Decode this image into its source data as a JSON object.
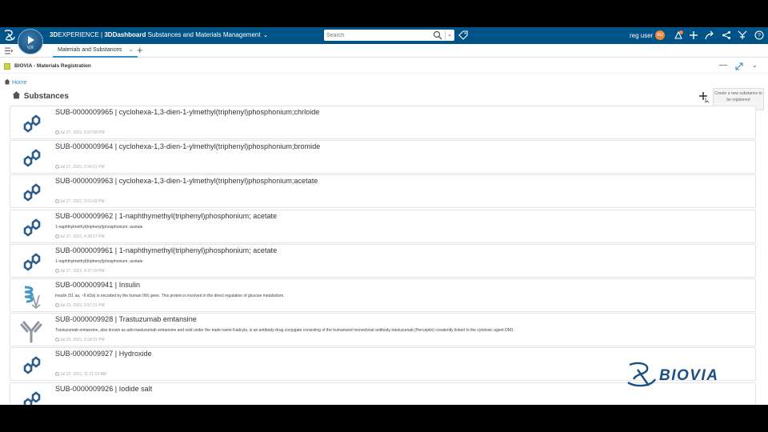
{
  "topbar": {
    "brand": "3D",
    "brand_rest": "EXPERIENCE",
    "separator": " | ",
    "dashboard": "3DDashboard",
    "dashboard_name": "Substances and Materials Management",
    "compass_label": "V,R",
    "search_placeholder": "Search",
    "user": "reg user",
    "avatar_initials": "RU",
    "notification_count": "5",
    "bar_color": "#005386"
  },
  "tabs": [
    {
      "label": "Materials and Substances"
    }
  ],
  "widget": {
    "title": "BIOVIA - Materials Registration"
  },
  "breadcrumb": {
    "home": "Home"
  },
  "page": {
    "title": "Substances",
    "add_tooltip": "Create a new substance to be registered"
  },
  "substances": [
    {
      "title": "SUB-0000009965 | cyclohexa-1,3-dien-1-ylmethyl(triphenyl)phosphonium;chrloide",
      "desc": "",
      "date": "Jul 27, 2021, 5:07:58 PM",
      "icon": "molecule-icon"
    },
    {
      "title": "SUB-0000009964 | cyclohexa-1,3-dien-1-ylmethyl(triphenyl)phosphonium;bromide",
      "desc": "",
      "date": "Jul 27, 2021, 5:04:21 PM",
      "icon": "molecule-icon"
    },
    {
      "title": "SUB-0000009963 | cyclohexa-1,3-dien-1-ylmethyl(triphenyl)phosphonium;acetate",
      "desc": "",
      "date": "Jul 27, 2021, 5:03:43 PM",
      "icon": "molecule-icon"
    },
    {
      "title": "SUB-0000009962 | 1-naphthymethyl(triphenyl)phosphonium; acetate",
      "desc": "1-naphthylmethyl(triphenyl)phosphonium; acetate",
      "date": "Jul 27, 2021, 4:38:17 PM",
      "icon": "molecule-icon"
    },
    {
      "title": "SUB-0000009961 | 1-naphthymethyl(triphenyl)phosphonium; acetate",
      "desc": "1-naphthylmethyl(triphenyl)phosphonium; acetate",
      "date": "Jul 27, 2021, 4:37:19 PM",
      "icon": "molecule-icon"
    },
    {
      "title": "SUB-0000009941 | Insulin",
      "desc": "Insulin (51 aa, ~6 kDa) is encoded by the human INS gene. This protein is involved in the direct regulation of glucose metabolism.",
      "date": "Jul 23, 2021, 5:57:21 PM",
      "icon": "protein-icon"
    },
    {
      "title": "SUB-0000009928 | Trastuzumab emtansine",
      "desc": "Trastuzumab emtansine, also known as ado-trastuzumab emtansine and sold under the trade name Kadcyla, is an antibody-drug conjugate consisting of the humanized monoclonal antibody trastuzumab (Herceptin) covalently linked to the cytotoxic agent DM1.",
      "date": "Jul 23, 2021, 3:18:31 PM",
      "icon": "antibody-icon"
    },
    {
      "title": "SUB-0000009927 | Hydroxide",
      "desc": "",
      "date": "Jul 22, 2021, 11:21:19 AM",
      "icon": "molecule-icon"
    },
    {
      "title": "SUB-0000009926 | Iodide salt",
      "desc": "",
      "date": "",
      "icon": "molecule-icon"
    }
  ],
  "branding": {
    "logo_text": "BIOVIA"
  }
}
